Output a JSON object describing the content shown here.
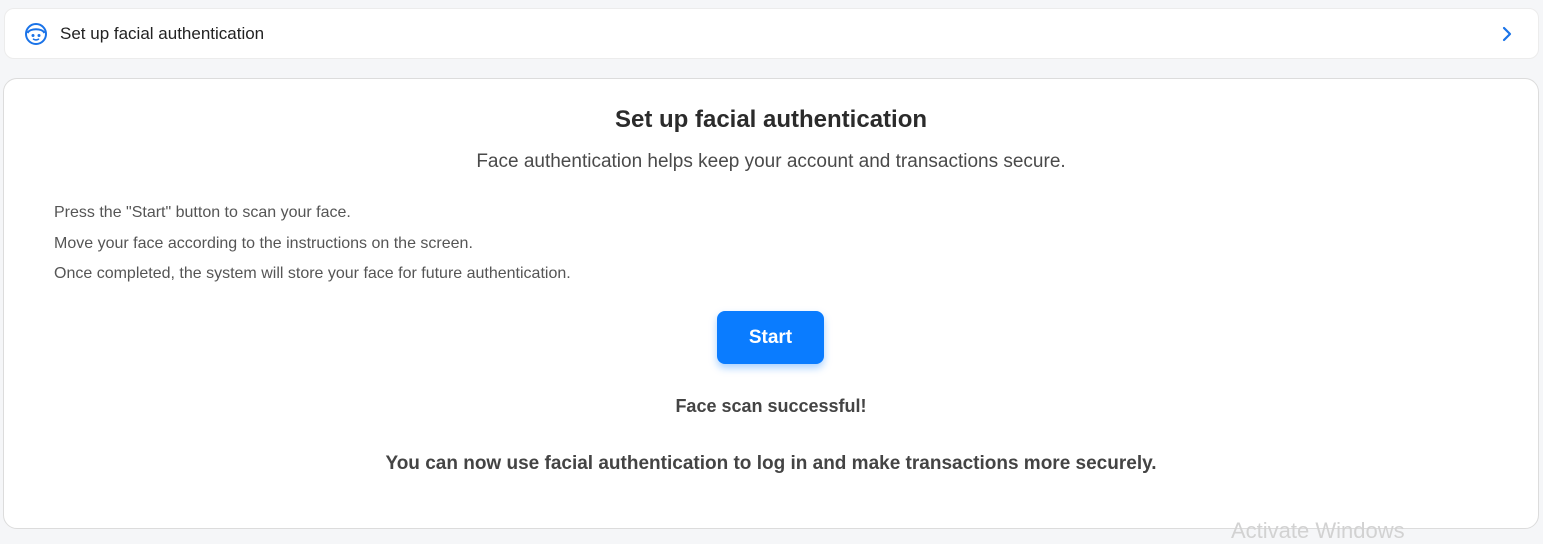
{
  "settings_row": {
    "icon": "face-id-icon",
    "label": "Set up facial authentication",
    "chevron_icon": "chevron-right-icon",
    "icon_color": "#1a73e8"
  },
  "setup_card": {
    "title": "Set up facial authentication",
    "subtitle": "Face authentication helps keep your account and transactions secure.",
    "instructions": [
      "Press the \"Start\" button to scan your face.",
      "Move your face according to the instructions on the screen.",
      "Once completed, the system will store your face for future authentication."
    ],
    "start_label": "Start",
    "start_color": "#0a7cff",
    "success_title": "Face scan successful!",
    "success_message": "You can now use facial authentication to log in and make transactions more securely."
  },
  "watermark": {
    "text": "Activate Windows"
  }
}
